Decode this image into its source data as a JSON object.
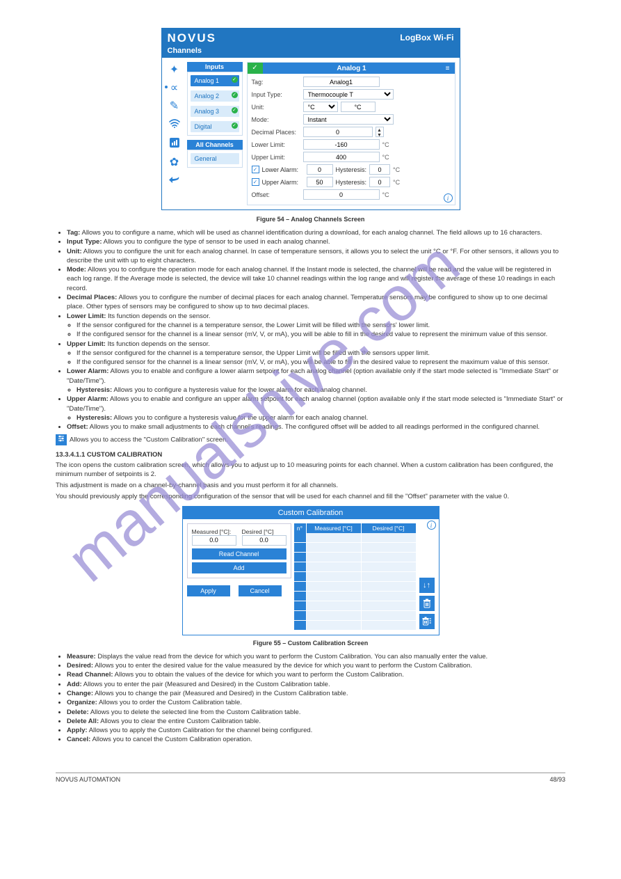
{
  "app": {
    "brand": "NOVUS",
    "product": "LogBox Wi-Fi",
    "section_title": "Channels",
    "inputs_header": "Inputs",
    "input_chips": [
      "Analog 1",
      "Analog 2",
      "Analog 3",
      "Digital"
    ],
    "all_channels_header": "All Channels",
    "general_chip": "General",
    "panel": {
      "title": "Analog 1",
      "rows": {
        "tag_label": "Tag:",
        "tag_value": "Analog1",
        "input_type_label": "Input Type:",
        "input_type_value": "Thermocouple T",
        "unit_label": "Unit:",
        "unit_sel": "°C",
        "unit_text": "°C",
        "mode_label": "Mode:",
        "mode_value": "Instant",
        "decimal_label": "Decimal Places:",
        "decimal_value": "0",
        "lower_limit_label": "Lower Limit:",
        "lower_limit_value": "-160",
        "lower_limit_unit": "°C",
        "upper_limit_label": "Upper Limit:",
        "upper_limit_value": "400",
        "upper_limit_unit": "°C",
        "lower_alarm_label": "Lower Alarm:",
        "lower_alarm_value": "0",
        "lower_alarm_hyst_label": "Hysteresis:",
        "lower_alarm_hyst_value": "0",
        "lower_alarm_unit": "°C",
        "upper_alarm_label": "Upper Alarm:",
        "upper_alarm_value": "50",
        "upper_alarm_hyst_label": "Hysteresis:",
        "upper_alarm_hyst_value": "0",
        "upper_alarm_unit": "°C",
        "offset_label": "Offset:",
        "offset_value": "0",
        "offset_unit": "°C"
      }
    }
  },
  "fig1_caption": "Figure 54 – Analog Channels Screen",
  "bullets": {
    "tag_t": "Tag:",
    "tag_d": "Allows you to configure a name, which will be used as channel identification during a download, for each analog channel. The field allows up to 16 characters.",
    "input_type_t": "Input Type:",
    "input_type_d": "Allows you to configure the type of sensor to be used in each analog channel.",
    "unit_t": "Unit:",
    "unit_d": "Allows you to configure the unit for each analog channel. In case of temperature sensors, it allows you to select the unit °C or °F. For other sensors, it allows you to describe the unit with up to eight characters.",
    "mode_t": "Mode:",
    "mode_d": "Allows you to configure the operation mode for each analog channel. If the Instant mode is selected, the channel will be read and the value will be registered in each log range. If the Average mode is selected, the device will take 10 channel readings within the log range and will register the average of these 10 readings in each record.",
    "dec_t": "Decimal Places:",
    "dec_d": "Allows you to configure the number of decimal places for each analog channel. Temperature sensors may be configured to show up to one decimal place. Other types of sensors may be configured to show up to two decimal places.",
    "low_t": "Lower Limit:",
    "low_d": "Its function depends on the sensor.",
    "low_sub1": "If the sensor configured for the channel is a temperature sensor, the Lower Limit will be filled with the sensors' lower limit.",
    "low_sub2": "If the configured sensor for the channel is a linear sensor (mV, V, or mA), you will be able to fill in the desired value to represent the minimum value of this sensor.",
    "up_t": "Upper Limit:",
    "up_d": "Its function depends on the sensor.",
    "up_sub1": "If the sensor configured for the channel is a temperature sensor, the Upper Limit will be filled with the sensors upper limit.",
    "up_sub2": "If the configured sensor for the channel is a linear sensor (mV, V, or mA), you will be able to fill in the desired value to represent the maximum value of this sensor.",
    "la_t": "Lower Alarm:",
    "la_d": "Allows you to enable and configure a lower alarm setpoint for each analog channel (option available only if the start mode selected is \"Immediate Start\" or \"Date/Time\").",
    "la_hyst_t": "Hysteresis:",
    "la_hyst_d": "Allows you to configure a hysteresis value for the lower alarm for each analog channel.",
    "ua_t": "Upper Alarm:",
    "ua_d": "Allows you to enable and configure an upper alarm setpoint for each analog channel (option available only if the start mode selected is \"Immediate Start\" or \"Date/Time\").",
    "ua_hyst_t": "Hysteresis:",
    "ua_hyst_d": "Allows you to configure a hysteresis value for the upper alarm for each analog channel.",
    "off_t": "Offset:",
    "off_d": "Allows you to make small adjustments to each channel's readings. The configured offset will be added to all readings performed in the configured channel."
  },
  "cc_link": "Allows you to access the \"Custom Calibration\" screen.",
  "cc_hdr": "13.3.4.1.1  CUSTOM CALIBRATION",
  "cc_intro": "The    icon opens the custom calibration screen, which allows you to adjust up to 10 measuring points for each channel. When a custom calibration has been configured, the minimum number of setpoints is 2.",
  "cc_note": "This adjustment is made on a channel-by-channel basis and you must perform it for all channels.",
  "cc_apply": "You should previously apply the corresponding configuration of the sensor that will be used for each channel and fill the \"Offset\" parameter with the value 0.",
  "calib": {
    "title": "Custom Calibration",
    "measured_label": "Measured [°C]:",
    "desired_label": "Desired [°C]",
    "measured_value": "0.0",
    "desired_value": "0.0",
    "read_btn": "Read Channel",
    "add_btn": "Add",
    "apply_btn": "Apply",
    "cancel_btn": "Cancel",
    "col_n": "n°",
    "col_measured": "Measured [°C]",
    "col_desired": "Desired [°C]"
  },
  "fig2_caption": "Figure 55 – Custom Calibration Screen",
  "bullets2": {
    "m_t": "Measure:",
    "m_d": "Displays the value read from the device for which you want to perform the Custom Calibration. You can also manually enter the value.",
    "d_t": "Desired:",
    "d_d": "Allows you to enter the desired value for the value measured by the device for which you want to perform the Custom Calibration.",
    "r_t": "Read Channel:",
    "r_d": "Allows you to obtain the values of the device for which you want to perform the Custom Calibration.",
    "a_t": "Add:",
    "a_d": "Allows you to enter the pair (Measured and Desired) in the Custom Calibration table.",
    "ch_t": "Change:",
    "ch_d": "Allows you to change the pair (Measured and Desired) in the Custom Calibration table.",
    "o_t": "Organize:",
    "o_d": "Allows you to order the Custom Calibration table.",
    "del_t": "Delete:",
    "del_d": "Allows you to delete the selected line from the Custom Calibration table.",
    "da_t": "Delete All:",
    "da_d": "Allows you to clear the entire Custom Calibration table.",
    "ap_t": "Apply:",
    "ap_d": "Allows you to apply the Custom Calibration for the channel being configured.",
    "cn_t": "Cancel:",
    "cn_d": "Allows you to cancel the Custom Calibration operation."
  },
  "footer": {
    "brand": "NOVUS AUTOMATION",
    "page": "48/93"
  },
  "watermark": "manualshive.com"
}
